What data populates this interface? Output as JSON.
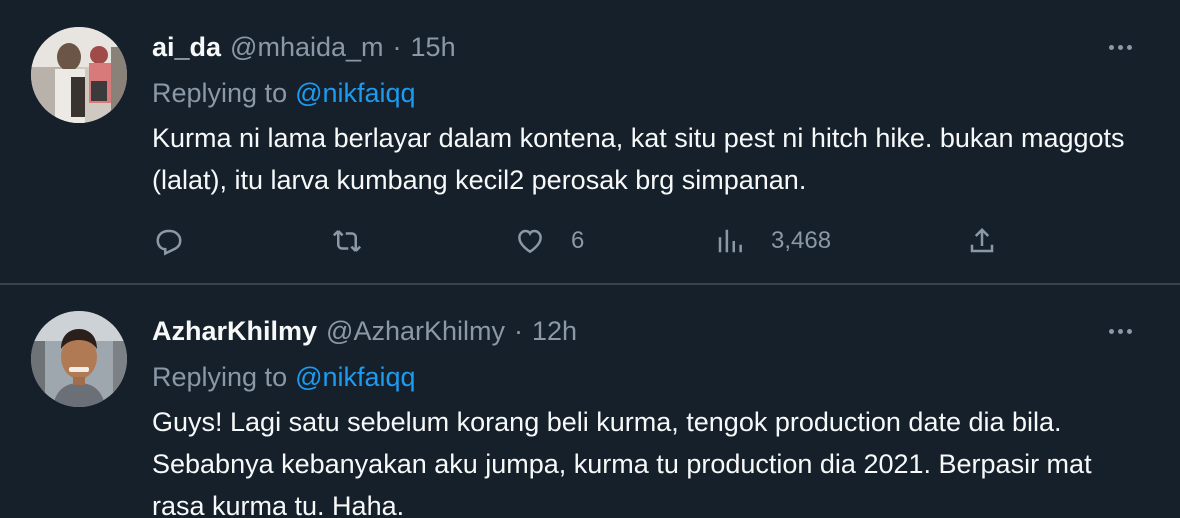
{
  "tweets": [
    {
      "name": "ai_da",
      "handle": "@mhaida_m",
      "dot": "·",
      "time": "15h",
      "replying_label": "Replying to",
      "replying_to": "@nikfaiqq",
      "text": "Kurma ni lama berlayar dalam kontena, kat situ pest ni hitch hike. bukan maggots (lalat), itu larva kumbang kecil2 perosak brg simpanan.",
      "likes": "6",
      "views": "3,468"
    },
    {
      "name": "AzharKhilmy",
      "handle": "@AzharKhilmy",
      "dot": "·",
      "time": "12h",
      "replying_label": "Replying to",
      "replying_to": "@nikfaiqq",
      "text": "Guys! Lagi satu sebelum korang beli kurma, tengok production date dia bila. Sebabnya kebanyakan aku jumpa, kurma tu production dia 2021. Berpasir mat rasa kurma tu. Haha."
    }
  ],
  "icons": {
    "reply": "reply-icon",
    "retweet": "retweet-icon",
    "like": "heart-icon",
    "views": "views-icon",
    "share": "share-icon",
    "more": "more-icon"
  },
  "colors": {
    "background": "#15202b",
    "text": "#f7f9f9",
    "secondary": "#8b98a5",
    "link": "#1d9bf0",
    "divider": "#38444d"
  }
}
